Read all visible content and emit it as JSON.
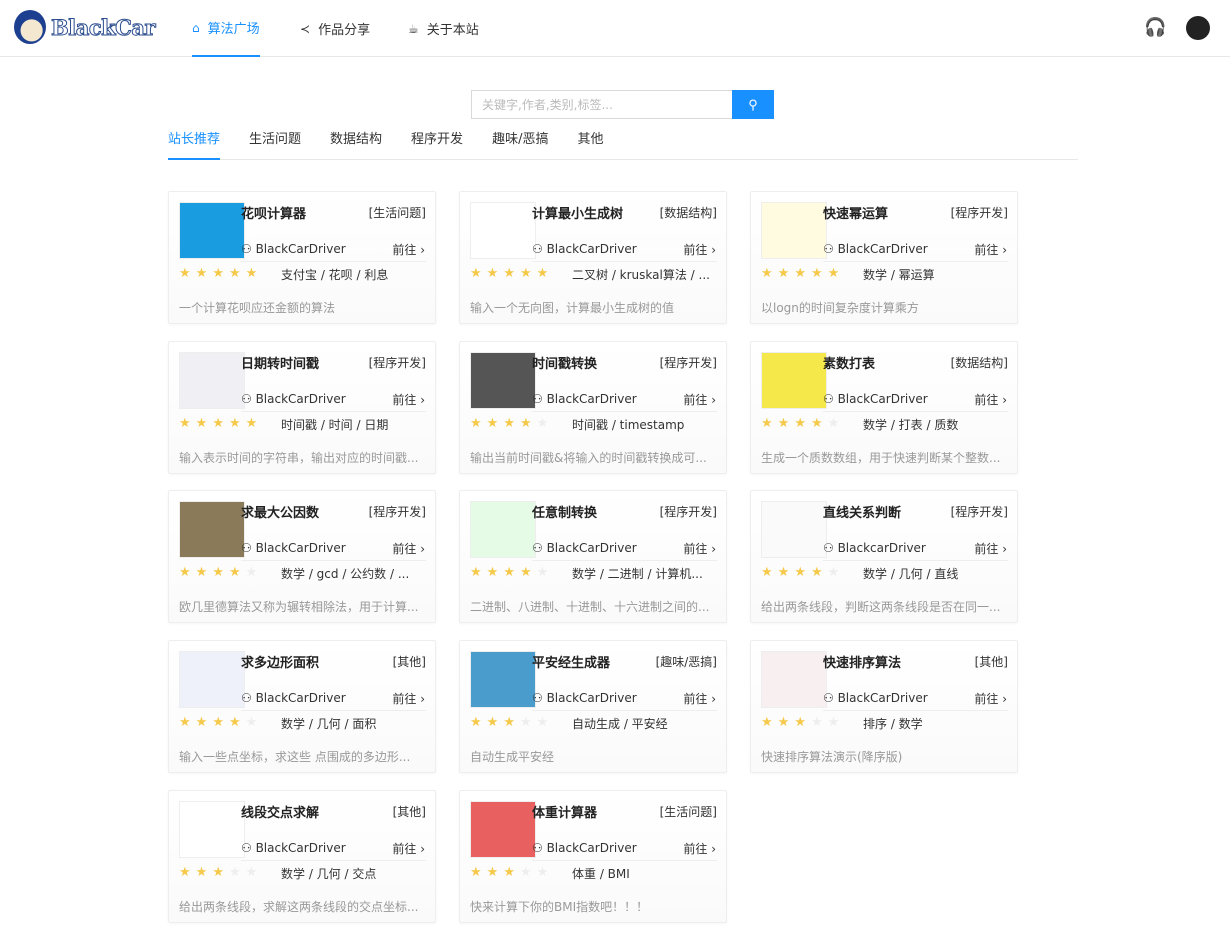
{
  "header": {
    "logo_text": "BlackCar",
    "nav": [
      {
        "label": "算法广场",
        "icon": "home-icon"
      },
      {
        "label": "作品分享",
        "icon": "share-icon"
      },
      {
        "label": "关于本站",
        "icon": "coffee-icon"
      }
    ]
  },
  "search": {
    "placeholder": "关键字,作者,类别,标签..."
  },
  "tabs": [
    "站长推荐",
    "生活问题",
    "数据结构",
    "程序开发",
    "趣味/恶搞",
    "其他"
  ],
  "go_label": "前往",
  "cards": [
    {
      "title": "花呗计算器",
      "category": "[生活问题]",
      "author": "BlackCarDriver",
      "rating": 5,
      "tags": "支付宝 / 花呗 / 利息",
      "desc": "一个计算花呗应还金额的算法",
      "thumb_color": "#1a9ce0"
    },
    {
      "title": "计算最小生成树",
      "category": "[数据结构]",
      "author": "BlackCarDriver",
      "rating": 5,
      "tags": "二叉树 / kruskal算法 / ...",
      "desc": "输入一个无向图，计算最小生成树的值",
      "thumb_color": "#ffffff"
    },
    {
      "title": "快速幂运算",
      "category": "[程序开发]",
      "author": "BlackCarDriver",
      "rating": 5,
      "tags": "数学 / 幂运算",
      "desc": "以logn的时间复杂度计算乘方",
      "thumb_color": "#fffbe0"
    },
    {
      "title": "日期转时间戳",
      "category": "[程序开发]",
      "author": "BlackCarDriver",
      "rating": 5,
      "tags": "时间戳 / 时间 / 日期",
      "desc": "输入表示时间的字符串，输出对应的时间戳...",
      "thumb_color": "#f0f0f4"
    },
    {
      "title": "时间戳转换",
      "category": "[程序开发]",
      "author": "BlackCarDriver",
      "rating": 4,
      "tags": "时间戳 / timestamp",
      "desc": "输出当前时间戳&将输入的时间戳转换成可...",
      "thumb_color": "#555555"
    },
    {
      "title": "素数打表",
      "category": "[数据结构]",
      "author": "BlackCarDriver",
      "rating": 4,
      "tags": "数学 / 打表 / 质数",
      "desc": "生成一个质数数组，用于快速判断某个整数...",
      "thumb_color": "#f4e84a"
    },
    {
      "title": "求最大公因数",
      "category": "[程序开发]",
      "author": "BlackCarDriver",
      "rating": 4,
      "tags": "数学 / gcd / 公约数 / ...",
      "desc": "欧几里德算法又称为辗转相除法，用于计算...",
      "thumb_color": "#8a7a5a"
    },
    {
      "title": "任意制转换",
      "category": "[程序开发]",
      "author": "BlackCarDriver",
      "rating": 4,
      "tags": "数学 / 二进制 / 计算机...",
      "desc": "二进制、八进制、十进制、十六进制之间的...",
      "thumb_color": "#e6fbe6"
    },
    {
      "title": "直线关系判断",
      "category": "[程序开发]",
      "author": "BlackcarDriver",
      "rating": 4,
      "tags": "数学 / 几何 / 直线",
      "desc": "给出两条线段，判断这两条线段是否在同一...",
      "thumb_color": "#fafafa"
    },
    {
      "title": "求多边形面积",
      "category": "[其他]",
      "author": "BlackCarDriver",
      "rating": 4,
      "tags": "数学 / 几何 / 面积",
      "desc": "输入一些点坐标，求这些 点围成的多边形...",
      "thumb_color": "#eef0fa"
    },
    {
      "title": "平安经生成器",
      "category": "[趣味/恶搞]",
      "author": "BlackCarDriver",
      "rating": 3,
      "tags": "自动生成 / 平安经",
      "desc": "自动生成平安经",
      "thumb_color": "#4a9ccc"
    },
    {
      "title": "快速排序算法",
      "category": "[其他]",
      "author": "BlackCarDriver",
      "rating": 3,
      "tags": "排序 / 数学",
      "desc": "快速排序算法演示(降序版)",
      "thumb_color": "#f8f0f0"
    },
    {
      "title": "线段交点求解",
      "category": "[其他]",
      "author": "BlackCarDriver",
      "rating": 3,
      "tags": "数学 / 几何 / 交点",
      "desc": "给出两条线段，求解这两条线段的交点坐标...",
      "thumb_color": "#ffffff"
    },
    {
      "title": "体重计算器",
      "category": "[生活问题]",
      "author": "BlackCarDriver",
      "rating": 3,
      "tags": "体重 / BMI",
      "desc": "快来计算下你的BMI指数吧！！！",
      "thumb_color": "#e86060"
    }
  ]
}
